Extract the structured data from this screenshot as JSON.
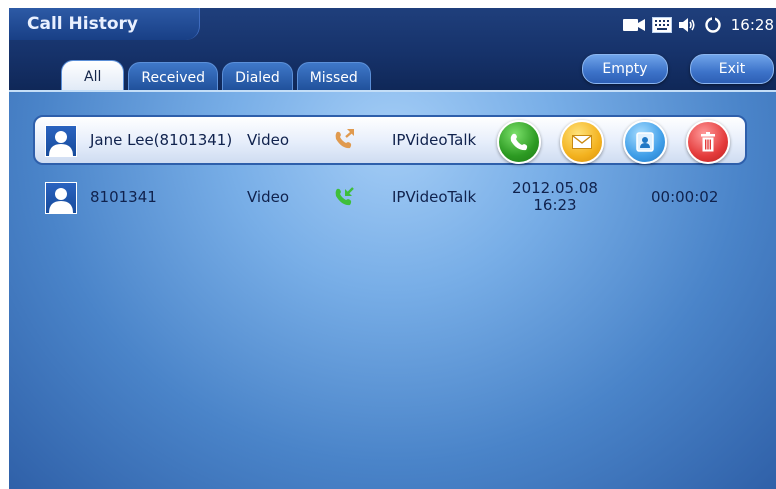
{
  "header": {
    "title": "Call History",
    "clock": "16:28",
    "status_icons": [
      "camera-icon",
      "keyboard-icon",
      "speaker-icon",
      "sync-icon"
    ]
  },
  "tabs": [
    {
      "label": "All",
      "active": true
    },
    {
      "label": "Received",
      "active": false
    },
    {
      "label": "Dialed",
      "active": false
    },
    {
      "label": "Missed",
      "active": false
    }
  ],
  "buttons": {
    "empty": "Empty",
    "exit": "Exit"
  },
  "calls": [
    {
      "name": "Jane Lee(8101341)",
      "mode": "Video",
      "direction_icon": "outgoing-call-icon",
      "network": "IPVideoTalk",
      "selected": true,
      "actions": [
        "call-icon",
        "message-icon",
        "contact-icon",
        "delete-icon"
      ]
    },
    {
      "name": "8101341",
      "mode": "Video",
      "direction_icon": "incoming-call-icon",
      "network": "IPVideoTalk",
      "date": "2012.05.08",
      "time": "16:23",
      "duration": "00:00:02",
      "selected": false
    }
  ],
  "colors": {
    "header_bg": "#16326a",
    "content_bg": "#78aee7",
    "row_text": "#10224d",
    "call_green": "#2c9a22",
    "message_yellow": "#f3b21f",
    "contact_blue": "#3f9ee8",
    "delete_red": "#e43b3b"
  }
}
